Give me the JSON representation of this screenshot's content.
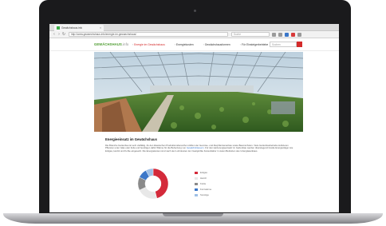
{
  "browser": {
    "tab_title": "Gewächshaus.info",
    "tab_close": "×",
    "url": "http://www.gewaechshaus.info/energie-im-gewaechshaus/",
    "search_placeholder": "Suche",
    "back": "‹",
    "forward": "›",
    "reload": "↻"
  },
  "site": {
    "logo": "GEWÄCHSHAUS",
    "logo_tld": ".info",
    "nav": [
      {
        "label": "Energie im Gewächshaus",
        "active": true
      },
      {
        "label": "Energiekosten",
        "active": false
      },
      {
        "label": "Gewächshausformen",
        "active": false
      },
      {
        "label": "Für Einsteigerbetriebe",
        "active": false
      }
    ],
    "search_placeholder": "Suchen"
  },
  "content": {
    "title": "Energieeinsatz im Gewächshaus",
    "paragraph_1": "Die Branche Gartenbau ist sehr vielfältig. Zu den klassischen Produktionsbereichen zählen der Gemüse- und Zierpflanzenanbau sowie Baumschulen. Viele Gartenbaubetriebe kultivieren Pflanzen unter Glas oder Folie und benötigen dafür Wärme für die Beheizung von",
    "link_text": "Gewächshäusern",
    "paragraph_2": ". Für den Heizenergieeinsatz im Gartenbau werden überwiegend fossile Energieträger wie Erdgas, Heizöl und Kohle eingesetzt. Die Energiekosten sind nach den Lohnkosten der zweitgrößte Kostenfaktor in vielen Betrieben des Unterglasanbaus."
  },
  "chart_data": {
    "type": "pie",
    "series": [
      {
        "name": "Erdgas",
        "value": 46,
        "color": "#d42a3a"
      },
      {
        "name": "Heizöl",
        "value": 22,
        "color": "#e8e8e8"
      },
      {
        "name": "Kohle",
        "value": 14,
        "color": "#8a8a8a"
      },
      {
        "name": "Fernwärme",
        "value": 10,
        "color": "#3b77c9"
      },
      {
        "name": "Sonstige",
        "value": 8,
        "color": "#9fc0e6"
      }
    ]
  }
}
